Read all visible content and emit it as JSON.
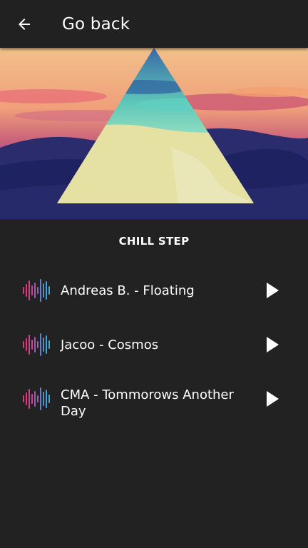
{
  "header": {
    "title": "Go back",
    "back_icon": "arrow-left-icon"
  },
  "hero": {
    "image": "triangle-sunset-artwork"
  },
  "playlist": {
    "title": "CHILL STEP",
    "tracks": [
      {
        "title": "Andreas B. - Floating",
        "icon": "sound-wave-icon",
        "action_icon": "play-icon"
      },
      {
        "title": "Jacoo - Cosmos",
        "icon": "sound-wave-icon",
        "action_icon": "play-icon"
      },
      {
        "title": "CMA - Tommorows Another Day",
        "icon": "sound-wave-icon",
        "action_icon": "play-icon"
      }
    ]
  },
  "colors": {
    "background": "#222222",
    "topbar": "#212121",
    "wave_pink": "#e0367a",
    "wave_blue": "#3aa8d8",
    "text": "#ffffff"
  }
}
